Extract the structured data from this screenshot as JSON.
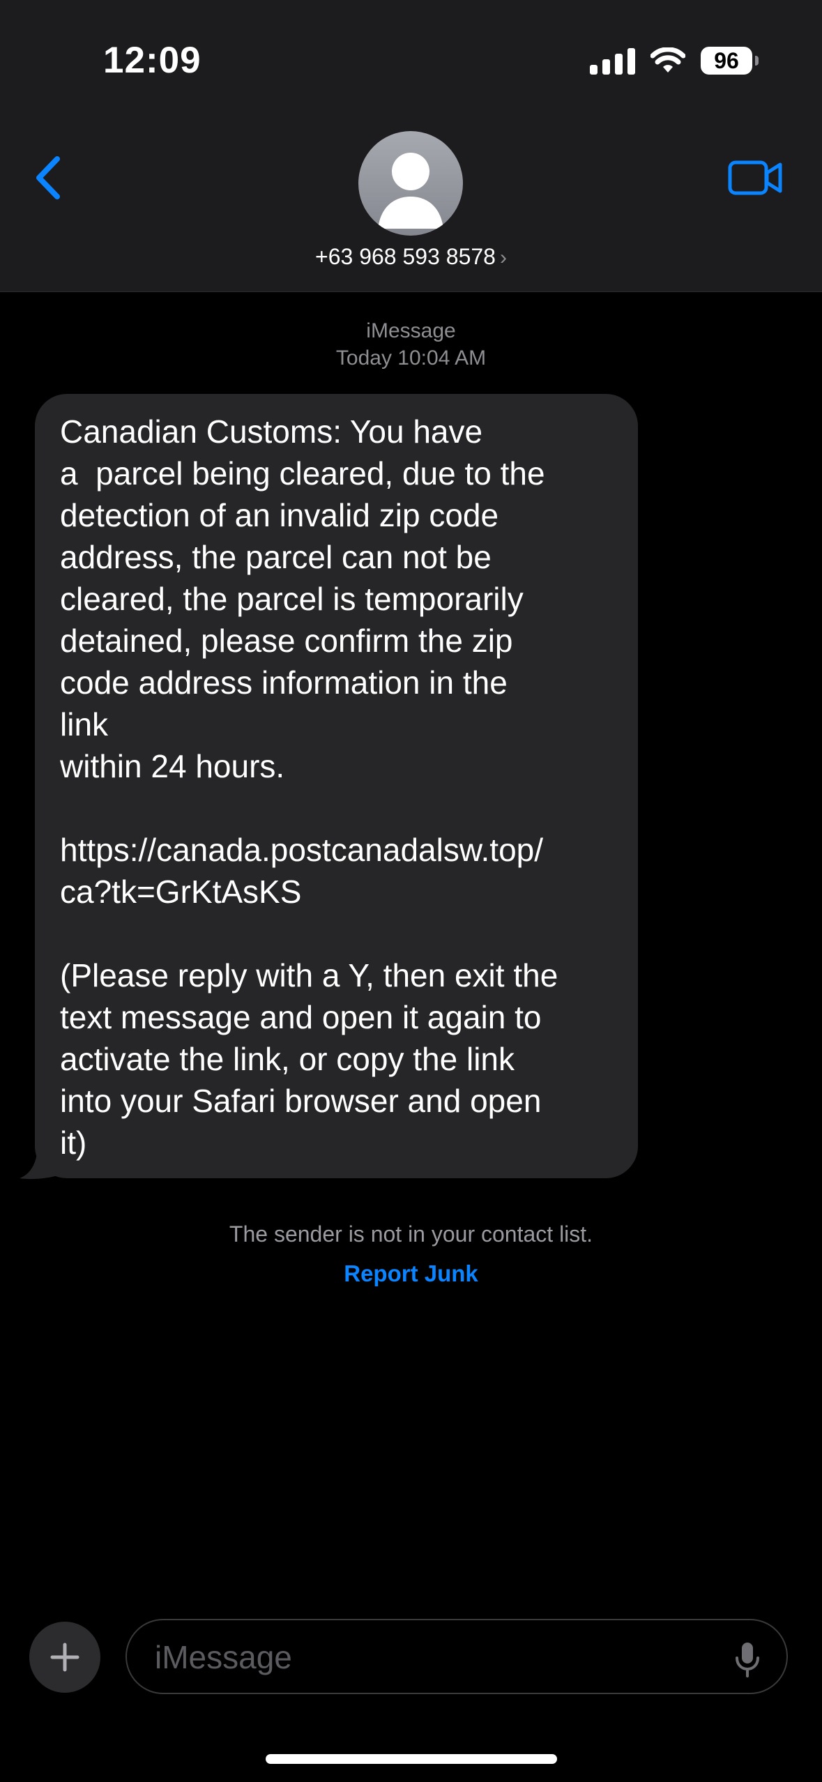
{
  "status_bar": {
    "time": "12:09",
    "battery_level": "96",
    "signal_icon": "cellular-signal-icon",
    "wifi_icon": "wifi-icon"
  },
  "header": {
    "back_icon": "chevron-left-icon",
    "contact_name": "+63 968 593 8578",
    "contact_chevron": "›",
    "video_icon": "video-camera-icon",
    "avatar_icon": "person-placeholder-icon"
  },
  "conversation": {
    "service_label": "iMessage",
    "timestamp": "Today 10:04 AM",
    "message": {
      "lines_1": [
        "Canadian Customs: You have",
        "a  parcel being cleared, due to the",
        "detection of an invalid zip code",
        "address, the parcel can not be",
        "cleared, the parcel is temporarily",
        "detained, please confirm the zip",
        "code address information in the",
        "link",
        "within 24 hours."
      ],
      "link_lines": [
        "https://canada.postcanadalsw.top/",
        "ca?tk=GrKtAsKS"
      ],
      "lines_2": [
        "(Please reply with a Y, then exit the",
        "text message and open it again to",
        "activate the link, or copy the link",
        "into your Safari browser and open",
        "it)"
      ]
    },
    "notice": "The sender is not in your contact list.",
    "report_junk": "Report Junk"
  },
  "composer": {
    "plus_icon": "plus-icon",
    "placeholder": "iMessage",
    "mic_icon": "microphone-icon"
  },
  "colors": {
    "accent": "#0a84ff",
    "header_bg": "#1c1c1e",
    "bubble_bg": "#262628",
    "background": "#000000"
  }
}
